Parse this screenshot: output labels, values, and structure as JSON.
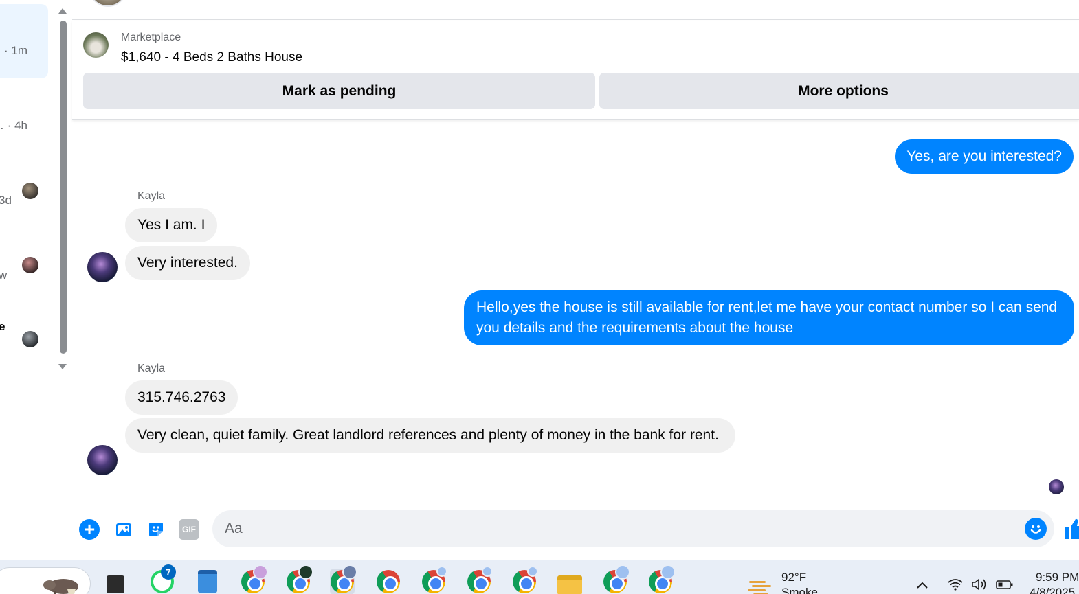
{
  "chat_list": {
    "items": [
      {
        "time": "· 1m"
      },
      {
        "time": "… · 4h"
      },
      {
        "time": "3d"
      },
      {
        "time": "w"
      },
      {
        "time": "e"
      }
    ]
  },
  "marketplace": {
    "label": "Marketplace",
    "listing_title": "$1,640 - 4 Beds 2 Baths House",
    "mark_pending_label": "Mark as pending",
    "more_options_label": "More options"
  },
  "conversation": {
    "messages": [
      {
        "direction": "out",
        "text": "Yes, are you interested?"
      },
      {
        "direction": "in",
        "sender": "Kayla",
        "text": "Yes I am. I"
      },
      {
        "direction": "in",
        "text": "Very interested."
      },
      {
        "direction": "out",
        "text": "Hello,yes the house is still available for rent,let me have your contact number so I can send you details and the requirements about the house"
      },
      {
        "direction": "in",
        "sender": "Kayla",
        "text": "315.746.2763"
      },
      {
        "direction": "in",
        "text": "Very clean, quiet family. Great landlord references and plenty of money in the bank for rent."
      }
    ]
  },
  "composer": {
    "placeholder": "Aa",
    "gif_label": "GIF",
    "icons": [
      "plus-icon",
      "photo-icon",
      "sticker-icon",
      "gif-icon",
      "emoji-icon",
      "thumbs-up-icon"
    ]
  },
  "taskbar": {
    "whatsapp_badge": "7",
    "weather_temp": "92°F",
    "weather_desc": "Smoke",
    "clock_time": "9:59 PM",
    "clock_date": "4/8/2025"
  },
  "colors": {
    "outgoing_bubble": "#0084ff",
    "incoming_bubble": "#f0f0f0",
    "button_bg": "#e4e6eb",
    "accent": "#0084ff"
  }
}
